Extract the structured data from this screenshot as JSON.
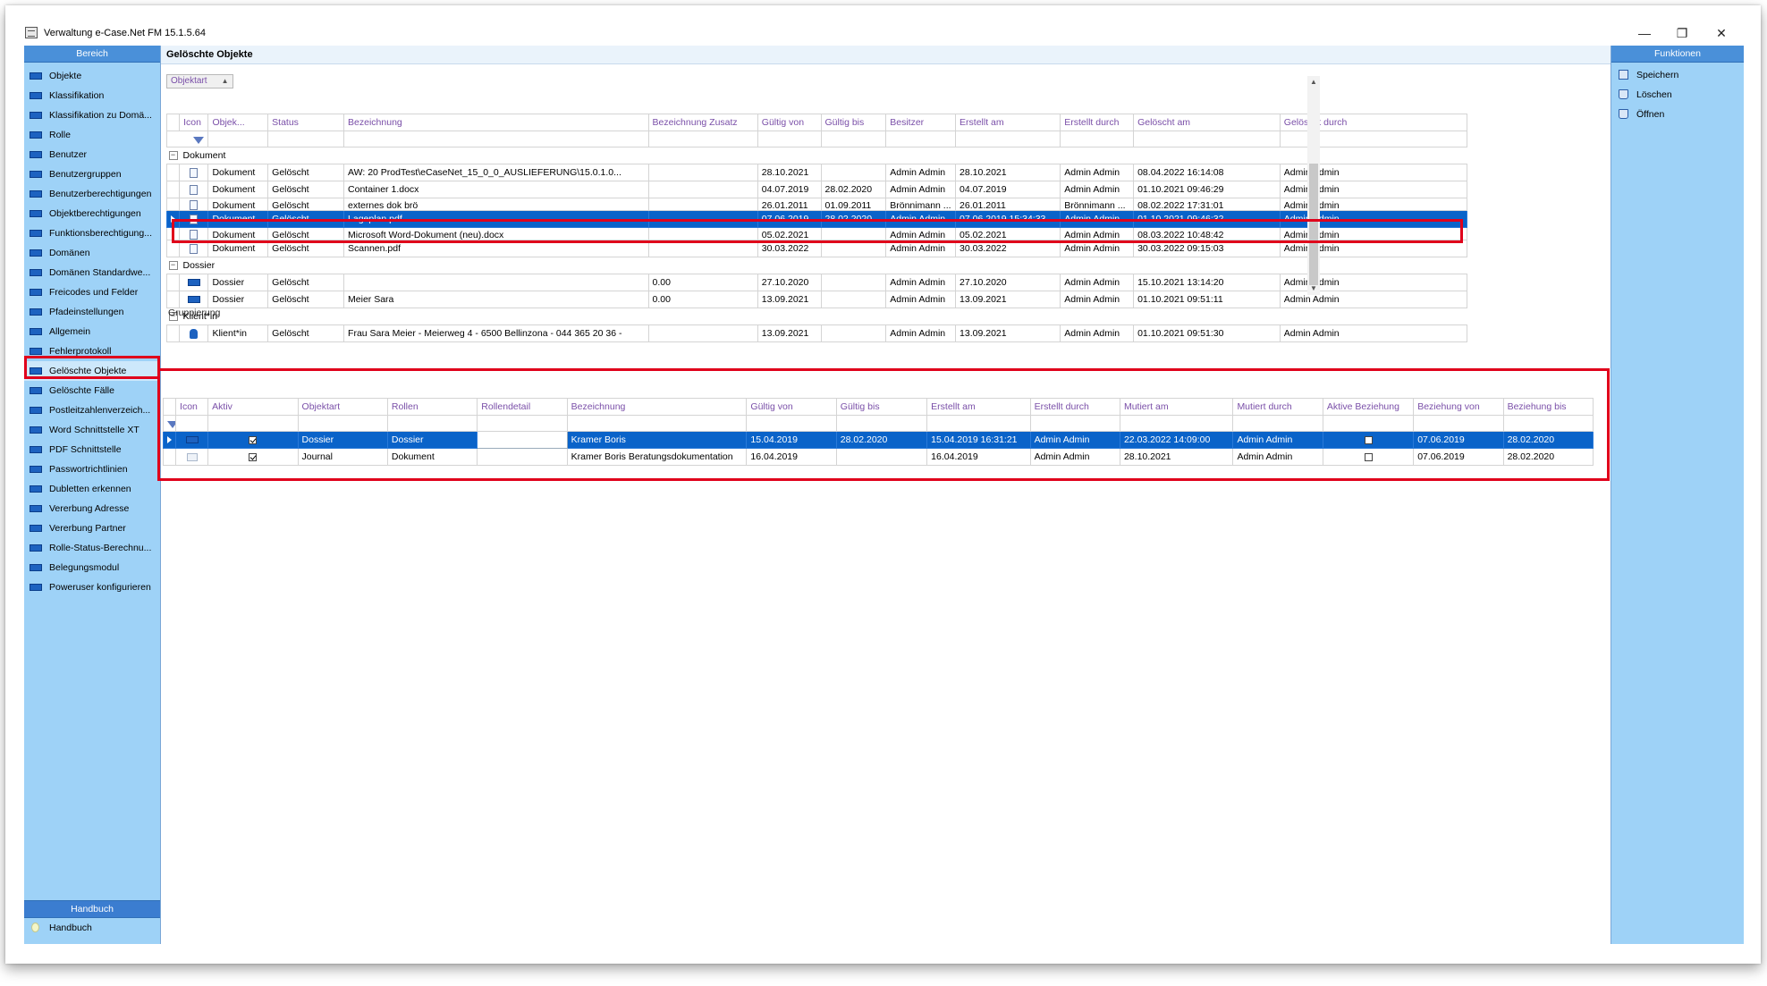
{
  "window": {
    "title": "Verwaltung e-Case.Net FM 15.1.5.64",
    "minimize": "—",
    "restore": "❐",
    "close": "✕"
  },
  "left_panel": {
    "header": "Bereich",
    "items": [
      "Objekte",
      "Klassifikation",
      "Klassifikation zu Domä...",
      "Rolle",
      "Benutzer",
      "Benutzergruppen",
      "Benutzerberechtigungen",
      "Objektberechtigungen",
      "Funktionsberechtigung...",
      "Domänen",
      "Domänen Standardwe...",
      "Freicodes und Felder",
      "Pfadeinstellungen",
      "Allgemein",
      "Fehlerprotokoll",
      "Gelöschte Objekte",
      "Gelöschte Fälle",
      "Postleitzahlenverzeich...",
      "Word Schnittstelle XT",
      "PDF Schnittstelle",
      "Passwortrichtlinien",
      "Dubletten erkennen",
      "Vererbung Adresse",
      "Vererbung Partner",
      "Rolle-Status-Berechnu...",
      "Belegungsmodul",
      "Poweruser konfigurieren"
    ],
    "handbuch_header": "Handbuch",
    "handbuch_item": "Handbuch"
  },
  "right_panel": {
    "header": "Funktionen",
    "items": [
      "Speichern",
      "Löschen",
      "Öffnen"
    ]
  },
  "main": {
    "title": "Gelöschte Objekte",
    "group_by": "Objektart",
    "columns": [
      "Icon",
      "Objek...",
      "Status",
      "Bezeichnung",
      "Bezeichnung Zusatz",
      "Gültig von",
      "Gültig bis",
      "Besitzer",
      "Erstellt am",
      "Erstellt durch",
      "Gelöscht am",
      "Gelöscht durch"
    ],
    "groups": [
      {
        "label": "Dokument",
        "rows": [
          [
            "Dokument",
            "Gelöscht",
            "AW: 20 ProdTest\\eCaseNet_15_0_0_AUSLIEFERUNG\\15.0.1.0...",
            "",
            "28.10.2021",
            "",
            "Admin Admin",
            "28.10.2021",
            "Admin Admin",
            "08.04.2022 16:14:08",
            "Admin Admin"
          ],
          [
            "Dokument",
            "Gelöscht",
            "Container 1.docx",
            "",
            "04.07.2019",
            "28.02.2020",
            "Admin Admin",
            "04.07.2019",
            "Admin Admin",
            "01.10.2021 09:46:29",
            "Admin Admin"
          ],
          [
            "Dokument",
            "Gelöscht",
            "externes dok brö",
            "",
            "26.01.2011",
            "01.09.2011",
            "Brönnimann ...",
            "26.01.2011",
            "Brönnimann ...",
            "08.02.2022 17:31:01",
            "Admin Admin"
          ],
          [
            "Dokument",
            "Gelöscht",
            "Lageplan.pdf",
            "",
            "07.06.2019",
            "28.02.2020",
            "Admin Admin",
            "07.06.2019 15:34:33",
            "Admin Admin",
            "01.10.2021 09:46:32",
            "Admin Admin"
          ],
          [
            "Dokument",
            "Gelöscht",
            "Microsoft Word-Dokument (neu).docx",
            "",
            "05.02.2021",
            "",
            "Admin Admin",
            "05.02.2021",
            "Admin Admin",
            "08.03.2022 10:48:42",
            "Admin Admin"
          ],
          [
            "Dokument",
            "Gelöscht",
            "Scannen.pdf",
            "",
            "30.03.2022",
            "",
            "Admin Admin",
            "30.03.2022",
            "Admin Admin",
            "30.03.2022 09:15:03",
            "Admin Admin"
          ]
        ]
      },
      {
        "label": "Dossier",
        "rows": [
          [
            "Dossier",
            "Gelöscht",
            "",
            "0.00",
            "27.10.2020",
            "",
            "Admin Admin",
            "27.10.2020",
            "Admin Admin",
            "15.10.2021 13:14:20",
            "Admin Admin"
          ],
          [
            "Dossier",
            "Gelöscht",
            "Meier Sara",
            "0.00",
            "13.09.2021",
            "",
            "Admin Admin",
            "13.09.2021",
            "Admin Admin",
            "01.10.2021 09:51:11",
            "Admin Admin"
          ]
        ]
      },
      {
        "label": "Klient*in",
        "rows": [
          [
            "Klient*in",
            "Gelöscht",
            "Frau Sara Meier -  Meierweg 4 -  6500 Bellinzona -  044 365 20 36 -",
            "",
            "13.09.2021",
            "",
            "Admin Admin",
            "13.09.2021",
            "Admin Admin",
            "01.10.2021 09:51:30",
            "Admin Admin"
          ]
        ]
      }
    ]
  },
  "sub": {
    "title": "Gruppierung",
    "columns": [
      "Icon",
      "Aktiv",
      "Objektart",
      "Rollen",
      "Rollendetail",
      "Bezeichnung",
      "Gültig von",
      "Gültig bis",
      "Erstellt am",
      "Erstellt durch",
      "Mutiert am",
      "Mutiert durch",
      "Aktive Beziehung",
      "Beziehung von",
      "Beziehung bis"
    ],
    "rows": [
      [
        "Dossier",
        "Dossier",
        "",
        "Kramer Boris",
        "15.04.2019",
        "28.02.2020",
        "15.04.2019 16:31:21",
        "Admin Admin",
        "22.03.2022 14:09:00",
        "Admin Admin",
        "07.06.2019",
        "28.02.2020"
      ],
      [
        "Journal",
        "Dokument",
        "",
        "Kramer Boris Beratungsdokumentation",
        "16.04.2019",
        "",
        "16.04.2019",
        "Admin Admin",
        "28.10.2021",
        "Admin Admin",
        "07.06.2019",
        "28.02.2020"
      ]
    ]
  }
}
